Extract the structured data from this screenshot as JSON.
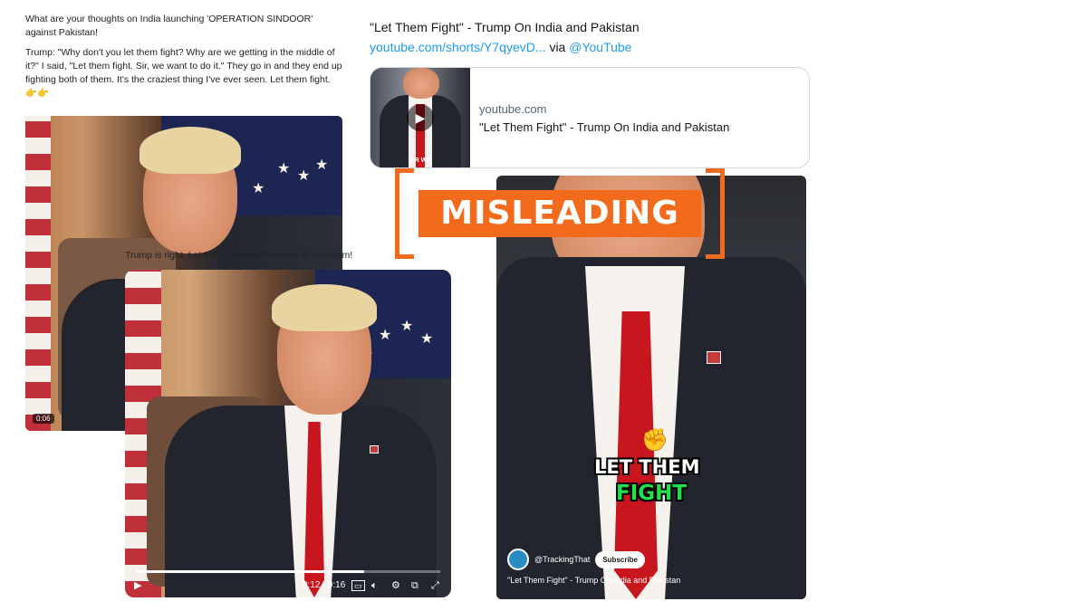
{
  "left_tweet": {
    "question": "What are your thoughts on India launching 'OPERATION SINDOOR' against Pakistan!",
    "quote": "Trump: \"Why don't you let them fight? Why are we getting in the middle of it?\" I said, \"Let them fight. Sir, we want to do it.\" They go in and they end up fighting both of them. It's the craziest thing I've ever seen. Let them fight.",
    "emoji": "👉👉",
    "video_time": "0:06"
  },
  "middle_post": {
    "caption": "Trump is right. Let India cleanse Pakistan of terrorism!",
    "player": {
      "time": "0:12 / 0:16",
      "progress": 0.75,
      "icons": [
        "play-icon",
        "captions-icon",
        "volume-icon",
        "settings-icon",
        "popout-icon",
        "fullscreen-icon"
      ]
    }
  },
  "right_tweet": {
    "text": "\"Let Them Fight\" - Trump On India and Pakistan",
    "link": "youtube.com/shorts/Y7qyevD...",
    "via_word": "via",
    "mention": "@YouTube",
    "card": {
      "domain": "youtube.com",
      "title": "\"Let Them Fight\" - Trump On India and Pakistan",
      "thumb_text": "SIR WE"
    }
  },
  "stamp": {
    "label": "MISLEADING",
    "color": "#f26a1b"
  },
  "short_video": {
    "overlay_line1": "LET THEM",
    "overlay_line2": "FIGHT",
    "channel": "@TrackingThat",
    "subscribe": "Subscribe",
    "title": "\"Let Them Fight\" - Trump On India and Pakistan"
  }
}
